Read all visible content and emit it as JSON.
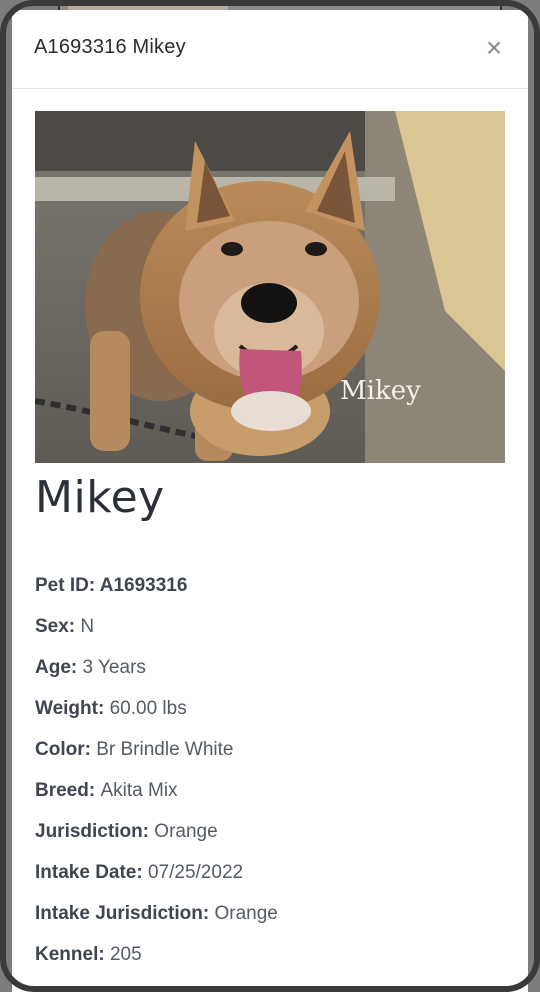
{
  "modal": {
    "title": "A1693316 Mikey",
    "close_glyph": "×"
  },
  "photo": {
    "overlay_text": "Mikey"
  },
  "pet": {
    "name": "Mikey",
    "details": [
      {
        "key": "Pet ID:",
        "value": "A1693316"
      },
      {
        "key": "Sex:",
        "value": "N"
      },
      {
        "key": "Age:",
        "value": "3 Years"
      },
      {
        "key": "Weight:",
        "value": "60.00 lbs"
      },
      {
        "key": "Color:",
        "value": "Br Brindle White"
      },
      {
        "key": "Breed:",
        "value": "Akita Mix"
      },
      {
        "key": "Jurisdiction:",
        "value": "Orange"
      },
      {
        "key": "Intake Date:",
        "value": "07/25/2022"
      },
      {
        "key": "Intake Jurisdiction:",
        "value": "Orange"
      },
      {
        "key": "Kennel:",
        "value": "205"
      }
    ]
  },
  "colors": {
    "backdrop": "#7c7c7c",
    "modal_bg": "#ffffff",
    "title_text": "#2b2b2b",
    "label_text": "#3f4650",
    "value_text": "#555b63"
  }
}
